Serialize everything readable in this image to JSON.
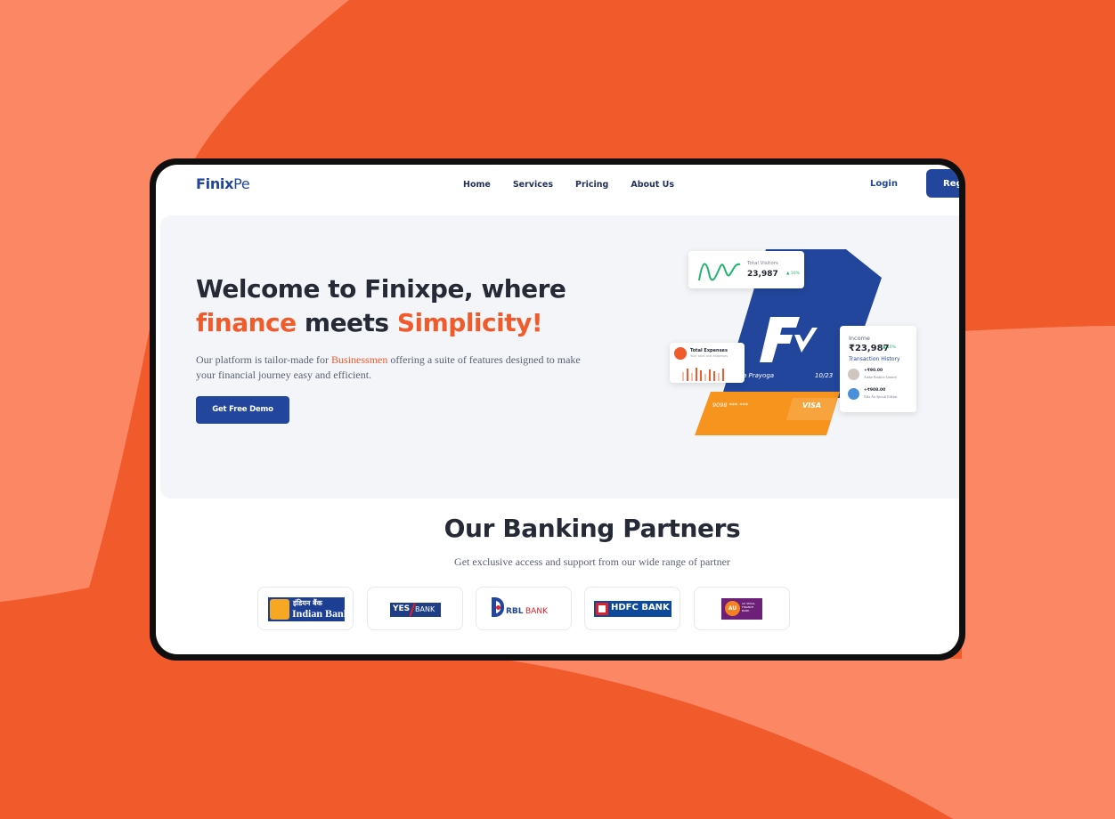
{
  "nav": {
    "logo": {
      "part1": "Finix",
      "part2": "Pe"
    },
    "menu": [
      "Home",
      "Services",
      "Pricing",
      "About Us"
    ],
    "login": "Login",
    "register": "Register"
  },
  "hero": {
    "title_line1": "Welcome to Finixpe, where",
    "title_word_finance": "finance",
    "title_word_meets": " meets ",
    "title_word_simplicity": "Simplicity!",
    "subtitle_before": "Our platform is tailor-made for ",
    "subtitle_highlight": "Businessmen",
    "subtitle_after": " offering a suite of features designed to make your financial journey easy and efficient.",
    "cta": "Get Free Demo"
  },
  "illustration": {
    "visitors_label": "Total Visitors",
    "visitors_value": "23,987",
    "visitors_change": "▲ 10%",
    "expenses_title": "Total Expenses",
    "expenses_sub": "Your total anti expenses",
    "card_name": "a Prayoga",
    "card_expiry": "10/23",
    "card_number": "9098 *** ***",
    "card_brand": "VISA",
    "income_label": "Income",
    "income_value": "₹23,987",
    "income_change": "▲ 10%",
    "history_title": "Transaction History",
    "transactions": [
      {
        "amount": "+₹90.00",
        "name": "Adobe Rouhice Limited"
      },
      {
        "amount": "+₹908.00",
        "name": "Nike Air Special Edition"
      }
    ]
  },
  "partners": {
    "title": "Our Banking Partners",
    "subtitle": "Get exclusive access and support from our wide range of partner",
    "banks": [
      {
        "hindi": "इंडियन बैंक",
        "name": "Indian Bank"
      },
      {
        "name_a": "YES",
        "name_b": "BANK"
      },
      {
        "name_a": "RBL",
        "name_b": "BANK"
      },
      {
        "name": "HDFC BANK"
      },
      {
        "mark": "AU",
        "name": "AU SMALL FINANCE BANK"
      }
    ]
  },
  "colors": {
    "brand_blue": "#22469b",
    "brand_orange": "#f15a2b",
    "background_orange": "#f15a2b",
    "background_light": "#fb8765"
  }
}
